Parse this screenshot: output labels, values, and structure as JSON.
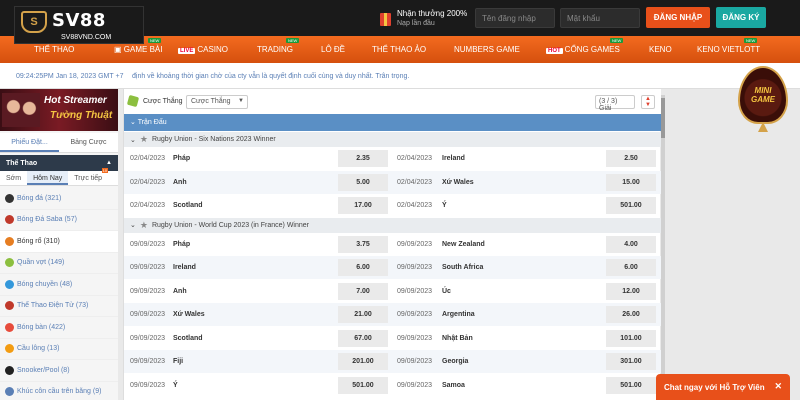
{
  "header": {
    "logo_mark": "S",
    "logo_text": "SV88",
    "logo_url": "SV88VND.COM",
    "promo_title": "Nhận thưởng 200%",
    "promo_sub": "Nạp lần đầu",
    "username_placeholder": "Tên đăng nhập",
    "password_placeholder": "Mật khẩu",
    "login_label": "ĐĂNG NHẬP",
    "register_label": "ĐĂNG KÝ"
  },
  "nav": {
    "items": [
      "THỂ THAO",
      "GAME BÀI",
      "CASINO",
      "TRADING",
      "LÔ ĐỀ",
      "THỂ THAO ẢO",
      "NUMBERS GAME",
      "CỔNG GAMES",
      "KENO",
      "KENO VIETLOTT"
    ],
    "live_tag": "LIVE",
    "hot_tag": "HOT",
    "new_tag": "NEW"
  },
  "subbar": {
    "clock": "09:24:25PM Jan 18, 2023 GMT +7",
    "ticker": "định về khoảng thời gian chờ của cty vẫn là quyết định cuối cùng và duy nhất. Trân trọng."
  },
  "sidebar": {
    "banner_line1": "Hot Streamer",
    "banner_line2": "Tường Thuật",
    "tabs": [
      "Phiếu Đặt...",
      "Bảng Cược"
    ],
    "sport_header": "Thể Thao",
    "time_tabs": [
      "Sớm",
      "Hôm Nay",
      "Trực tiếp"
    ],
    "live_count": "10",
    "sports": [
      {
        "label": "Bóng đá (321)",
        "color": "#333333"
      },
      {
        "label": "Bóng Đá Saba (57)",
        "color": "#c0392b"
      },
      {
        "label": "Bóng rổ (310)",
        "color": "#e67e22"
      },
      {
        "label": "Quần vợt (149)",
        "color": "#8cbf3f"
      },
      {
        "label": "Bóng chuyền (48)",
        "color": "#3498db"
      },
      {
        "label": "Thể Thao Điện Tử (73)",
        "color": "#c0392b"
      },
      {
        "label": "Bóng bàn (422)",
        "color": "#e74c3c"
      },
      {
        "label": "Cầu lông (13)",
        "color": "#f39c12"
      },
      {
        "label": "Snooker/Pool (8)",
        "color": "#222222"
      },
      {
        "label": "Khúc côn cầu trên băng (9)",
        "color": "#5a7fb5"
      }
    ]
  },
  "main": {
    "toolbar_label": "Cược Thắng",
    "select_value": "Cược Thắng",
    "pages": "(3 / 3) Giải",
    "section_title": "Trận Đấu",
    "leagues": [
      {
        "name": "Rugby Union - Six Nations 2023 Winner",
        "rows": [
          {
            "d1": "02/04/2023",
            "t1": "Pháp",
            "o1": "2.35",
            "d2": "02/04/2023",
            "t2": "Ireland",
            "o2": "2.50"
          },
          {
            "d1": "02/04/2023",
            "t1": "Anh",
            "o1": "5.00",
            "d2": "02/04/2023",
            "t2": "Xứ Wales",
            "o2": "15.00"
          },
          {
            "d1": "02/04/2023",
            "t1": "Scotland",
            "o1": "17.00",
            "d2": "02/04/2023",
            "t2": "Ý",
            "o2": "501.00"
          }
        ]
      },
      {
        "name": "Rugby Union - World Cup 2023 (in France) Winner",
        "rows": [
          {
            "d1": "09/09/2023",
            "t1": "Pháp",
            "o1": "3.75",
            "d2": "09/09/2023",
            "t2": "New Zealand",
            "o2": "4.00"
          },
          {
            "d1": "09/09/2023",
            "t1": "Ireland",
            "o1": "6.00",
            "d2": "09/09/2023",
            "t2": "South Africa",
            "o2": "6.00"
          },
          {
            "d1": "09/09/2023",
            "t1": "Anh",
            "o1": "7.00",
            "d2": "09/09/2023",
            "t2": "Úc",
            "o2": "12.00"
          },
          {
            "d1": "09/09/2023",
            "t1": "Xứ Wales",
            "o1": "21.00",
            "d2": "09/09/2023",
            "t2": "Argentina",
            "o2": "26.00"
          },
          {
            "d1": "09/09/2023",
            "t1": "Scotland",
            "o1": "67.00",
            "d2": "09/09/2023",
            "t2": "Nhật Bản",
            "o2": "101.00"
          },
          {
            "d1": "09/09/2023",
            "t1": "Fiji",
            "o1": "201.00",
            "d2": "09/09/2023",
            "t2": "Georgia",
            "o2": "301.00"
          },
          {
            "d1": "09/09/2023",
            "t1": "Ý",
            "o1": "501.00",
            "d2": "09/09/2023",
            "t2": "Samoa",
            "o2": "501.00"
          }
        ]
      }
    ]
  },
  "minigame_label": "MINI GAME",
  "chat_label": "Chat ngay với Hỗ Trợ Viên",
  "colors": {
    "brand_orange": "#e8501a",
    "accent_blue": "#5a8fc5",
    "register_teal": "#1aa8a1"
  }
}
